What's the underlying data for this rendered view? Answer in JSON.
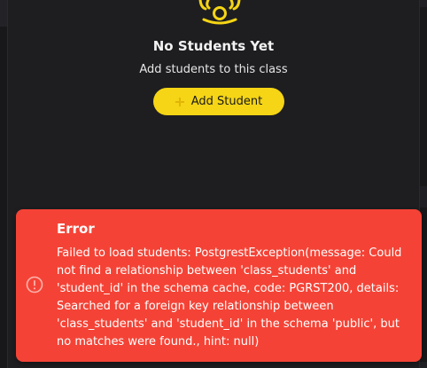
{
  "empty_state": {
    "icon": "people-group-icon",
    "title": "No Students Yet",
    "subtitle": "Add students to this class",
    "add_button": {
      "icon": "plus-icon",
      "label": "Add Student"
    }
  },
  "error_toast": {
    "icon": "alert-circle-icon",
    "title": "Error",
    "message": "Failed to load students: PostgrestException(message: Could\nnot find a relationship between 'class_students' and\n'student_id' in the schema cache, code: PGRST200, details:\nSearched for a foreign key relationship between\n'class_students' and 'student_id' in the schema 'public', but\nno matches were found., hint: null)"
  },
  "colors": {
    "background": "#1e1e21",
    "accent": "#f5d515",
    "error": "#f44336",
    "text": "#f2f2f2"
  }
}
